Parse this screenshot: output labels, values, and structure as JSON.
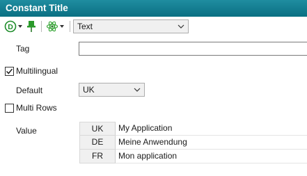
{
  "window": {
    "title": "Constant Title"
  },
  "toolbar": {
    "d_button_letter": "D",
    "type_combo": {
      "value": "Text"
    }
  },
  "form": {
    "tag": {
      "label": "Tag",
      "value": ""
    },
    "multilingual": {
      "label": "Multilingual",
      "checked": true
    },
    "default": {
      "label": "Default",
      "value": "UK"
    },
    "multi_rows": {
      "label": "Multi Rows",
      "checked": false
    },
    "value": {
      "label": "Value",
      "rows": [
        {
          "code": "UK",
          "text": "My Application"
        },
        {
          "code": "DE",
          "text": "Meine Anwendung"
        },
        {
          "code": "FR",
          "text": "Mon application"
        }
      ]
    }
  },
  "colors": {
    "titlebar": "#0a6f82",
    "d_icon": "#1e8c2a",
    "pin_icon": "#2a9a2a",
    "atom_icon": "#3aa73a"
  },
  "icons": [
    "d-circle-icon",
    "pin-icon",
    "atom-icon",
    "chevron-down-icon",
    "checkmark-icon"
  ]
}
